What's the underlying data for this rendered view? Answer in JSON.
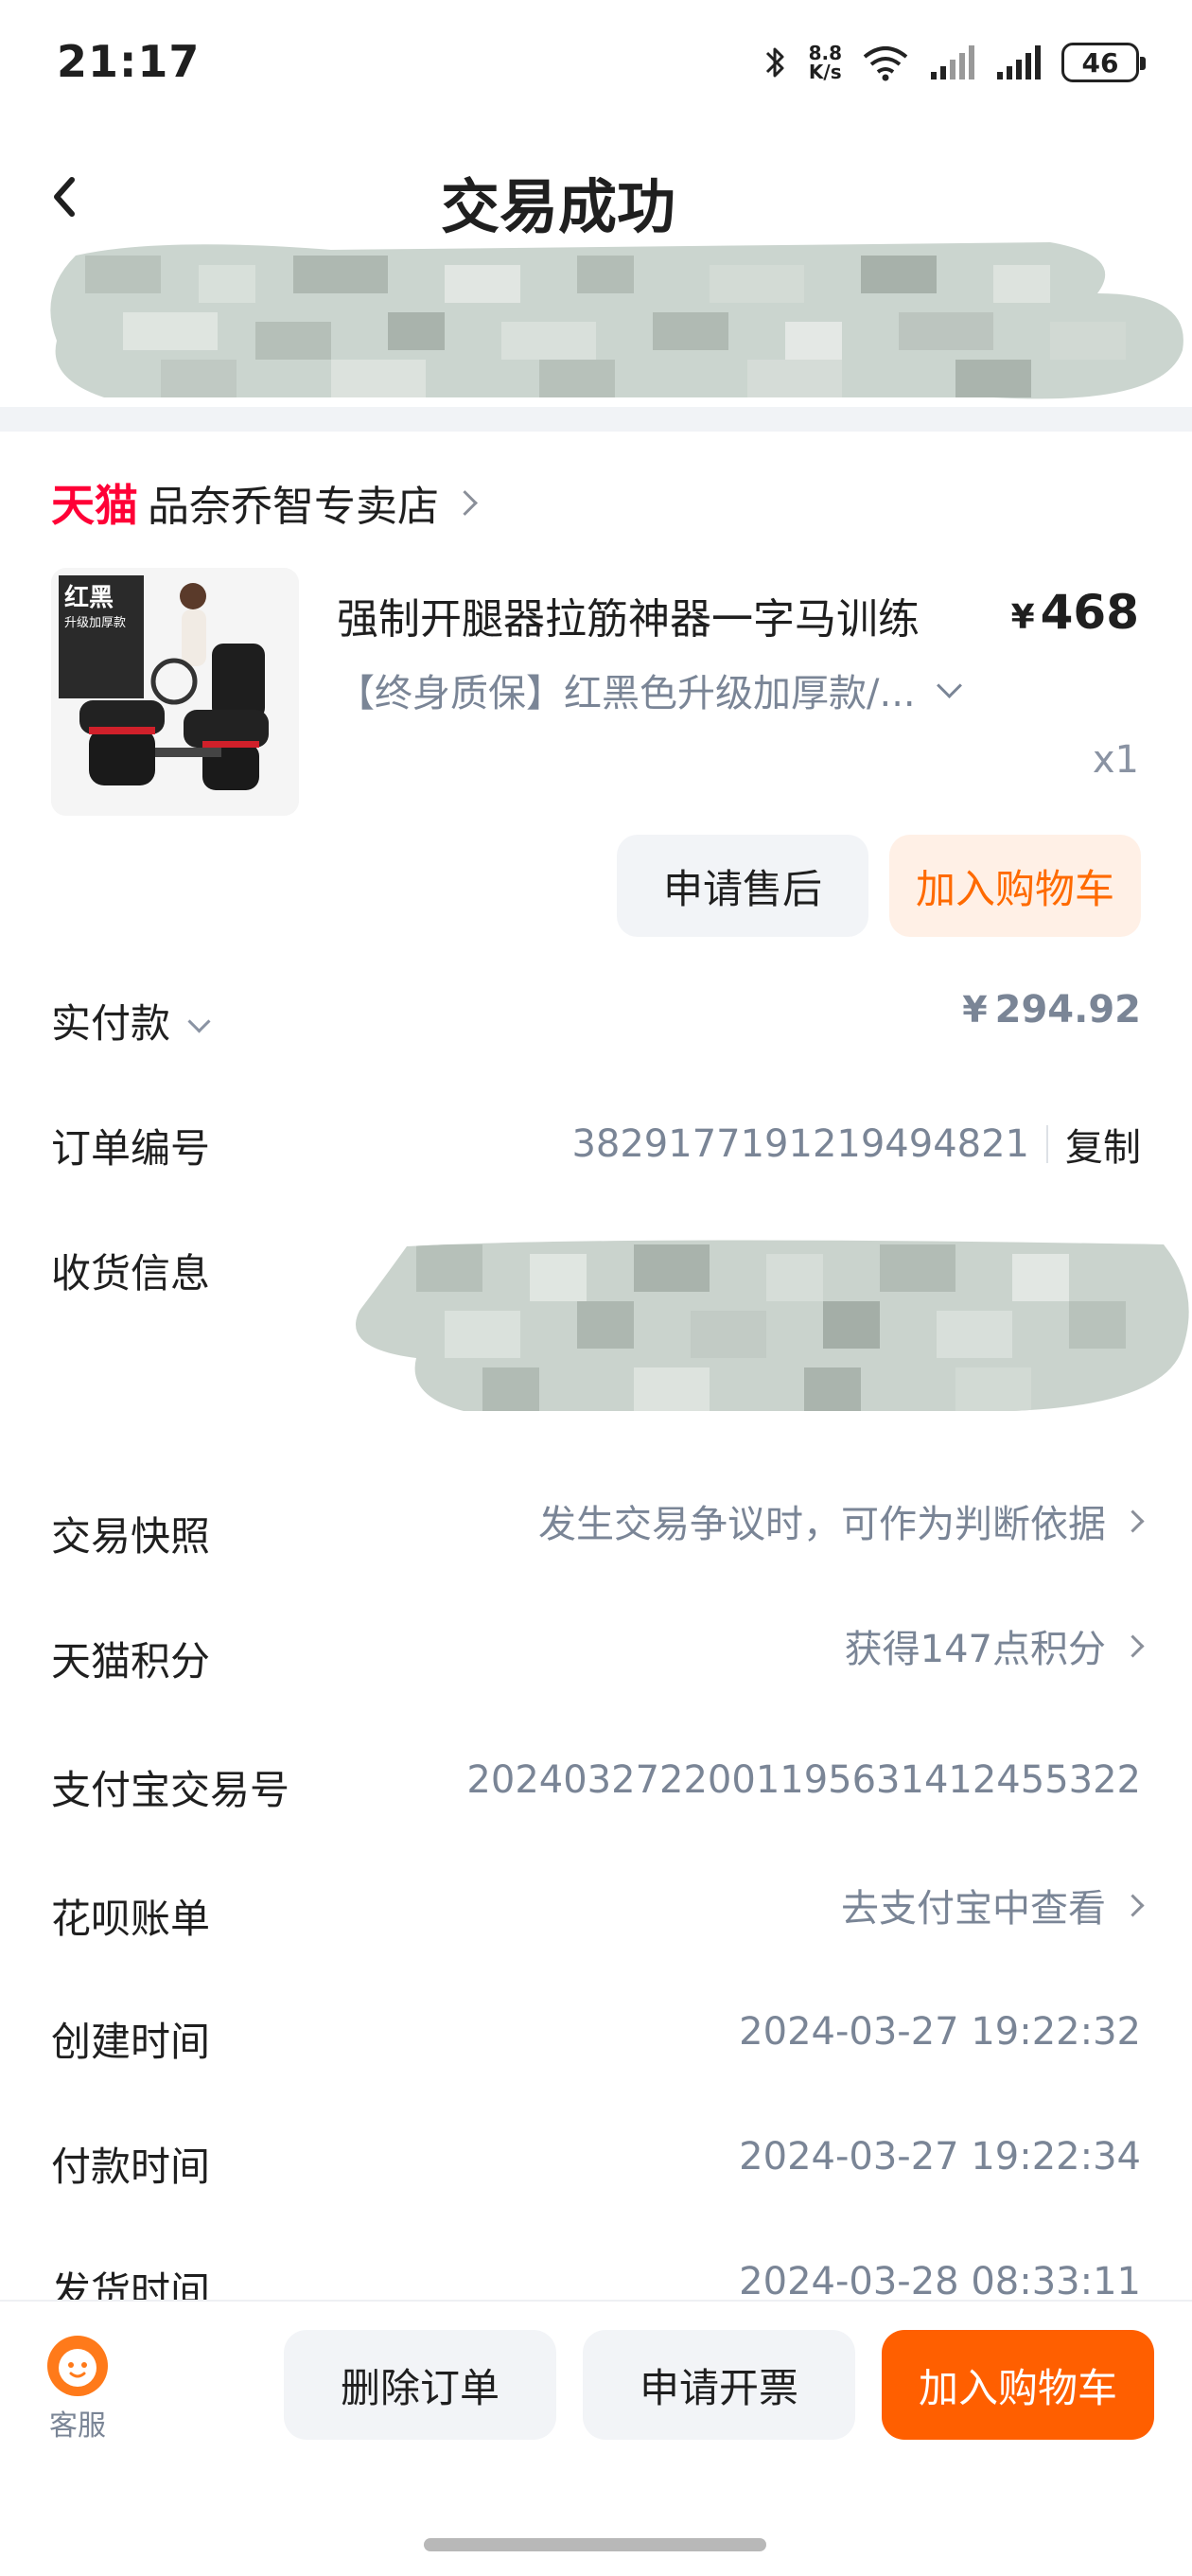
{
  "status_bar": {
    "time": "21:17",
    "speed_value": "8.8",
    "speed_unit": "K/s",
    "battery": "46",
    "icons": [
      "bluetooth-icon",
      "wifi-icon",
      "signal-icon",
      "signal-icon",
      "battery-icon"
    ]
  },
  "header": {
    "title": "交易成功",
    "back_icon": "chevron-left-icon"
  },
  "store": {
    "brand": "天猫",
    "name": "品奈乔智专卖店"
  },
  "product": {
    "name": "强制开腿器拉筋神器一字马训练",
    "price_symbol": "¥",
    "price": "468",
    "sku": "【终身质保】红黑色升级加厚款/...",
    "quantity": "x1",
    "image_badge": "红黑",
    "image_subtitle": "升级加厚款"
  },
  "product_actions": {
    "after_sale": "申请售后",
    "add_cart": "加入购物车"
  },
  "details": {
    "paid_label": "实付款",
    "paid_symbol": "¥",
    "paid_int": "294",
    "paid_cents": ".92",
    "order_no_label": "订单编号",
    "order_no": "3829177191219494821",
    "copy": "复制",
    "receiver_label": "收货信息",
    "snapshot_label": "交易快照",
    "snapshot_value": "发生交易争议时，可作为判断依据",
    "points_label": "天猫积分",
    "points_value": "获得147点积分",
    "alipay_label": "支付宝交易号",
    "alipay_value": "2024032722001195631412455322",
    "huabei_label": "花呗账单",
    "huabei_value": "去支付宝中查看",
    "created_label": "创建时间",
    "created_value": "2024-03-27 19:22:32",
    "paid_time_label": "付款时间",
    "paid_time_value": "2024-03-27 19:22:34",
    "shipped_label": "发货时间",
    "shipped_value": "2024-03-28 08:33:11"
  },
  "bottom_bar": {
    "service_label": "客服",
    "delete": "删除订单",
    "invoice": "申请开票",
    "add_cart": "加入购物车"
  },
  "colors": {
    "accent": "#ff5f00",
    "tmall_red": "#ff0036",
    "secondary_text": "#7a8596"
  }
}
